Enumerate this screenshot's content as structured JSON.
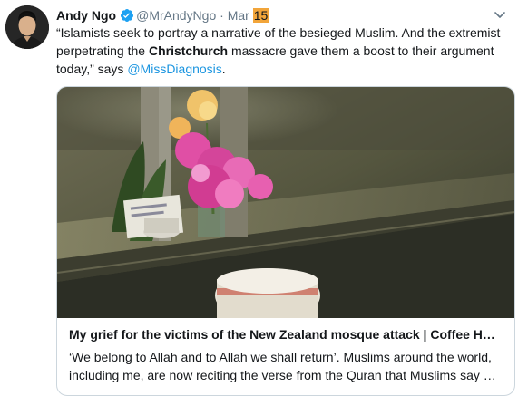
{
  "tweet": {
    "author_name": "Andy Ngo",
    "author_handle": "@MrAndyNgo",
    "separator": "·",
    "date_month": "Mar",
    "date_day": "15",
    "text_part1": "“Islamists seek to portray a narrative of the besieged Muslim. And the extremist perpetrating the ",
    "text_bold": "Christchurch",
    "text_part2": " massacre gave them a boost to their argument today,” says ",
    "mention": "@MissDiagnosis",
    "text_end": "."
  },
  "card": {
    "title": "My grief for the victims of the New Zealand mosque attack | Coffee House",
    "description_line1": "‘We belong to Allah and to Allah we shall return’. Muslims around the world,",
    "description_line2": "including me, are now reciting the verse from the Quran that Muslims say whenever"
  },
  "icons": {
    "verified": "verified-badge-icon",
    "caret": "chevron-down-icon"
  },
  "colors": {
    "link": "#1b95e0",
    "verified": "#1da1f2",
    "highlight": "#f2a53a"
  }
}
